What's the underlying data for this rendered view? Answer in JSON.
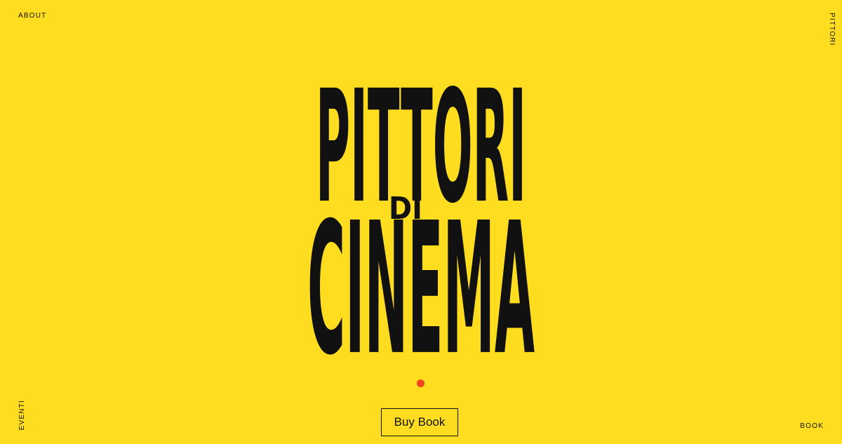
{
  "nav": {
    "about": "ABOUT",
    "pittori": "PITTORI",
    "eventi": "EVENTI",
    "book": "BOOK"
  },
  "logo": {
    "line1": "PITTORI",
    "line2": "DI",
    "line3": "CINEMA"
  },
  "cta": {
    "buy_label": "Buy Book"
  },
  "colors": {
    "background": "#FEDD21",
    "text": "#111111",
    "accent_dot": "#F0441E"
  }
}
